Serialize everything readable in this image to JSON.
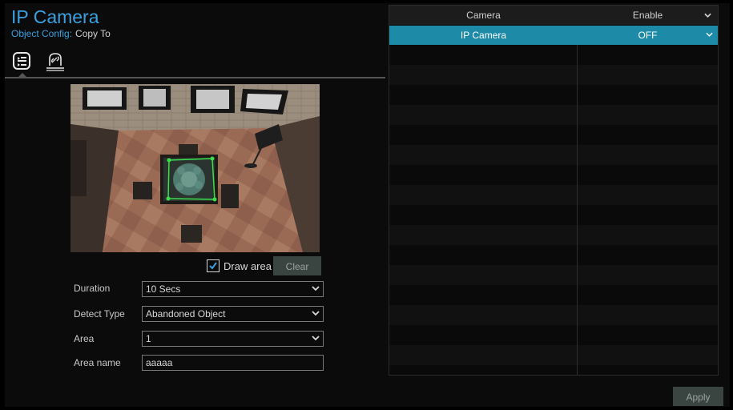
{
  "header": {
    "title": "IP Camera",
    "subnav_active": "Object Config:",
    "subnav_item": "Copy To"
  },
  "tabs": [
    {
      "icon": "list-settings-icon"
    },
    {
      "icon": "schedule-link-icon"
    }
  ],
  "preview": {
    "draw_area_label": "Draw area",
    "draw_area_checked": true,
    "clear_label": "Clear"
  },
  "form": {
    "duration": {
      "label": "Duration",
      "value": "10 Secs"
    },
    "detect_type": {
      "label": "Detect Type",
      "value": "Abandoned Object"
    },
    "area": {
      "label": "Area",
      "value": "1"
    },
    "area_name": {
      "label": "Area name",
      "value": "aaaaa"
    }
  },
  "table": {
    "columns": [
      "Camera",
      "Enable"
    ],
    "rows": [
      {
        "camera": "IP Camera",
        "enable": "OFF",
        "selected": true
      }
    ]
  },
  "footer": {
    "apply_label": "Apply"
  },
  "colors": {
    "accent": "#3aa0e0",
    "selected_row": "#1d8aa8",
    "button": "#3a4441"
  }
}
